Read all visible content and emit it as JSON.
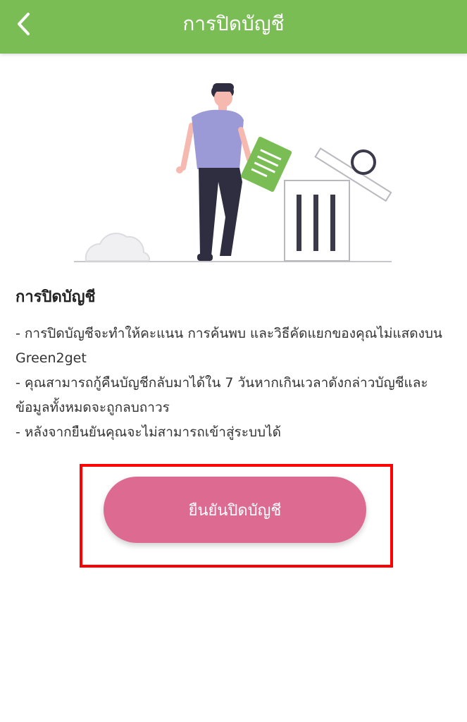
{
  "header": {
    "title": "การปิดบัญชี",
    "background_color": "#7bbd55",
    "back_icon": "chevron-left-icon"
  },
  "content": {
    "section_title": "การปิดบัญชี",
    "lines": [
      "- การปิดบัญชีจะทำให้คะแนน การค้นพบ และวิธีคัดแยกของคุณไม่แสดงบน  Green2get",
      "- คุณสามารถกู้คืนบัญชีกลับมาได้ใน 7 วันหากเกินเวลาดังกล่าวบัญชีและข้อมูลทั้งหมดจะถูกลบถาวร",
      "- หลังจากยืนยันคุณจะไม่สามารถเข้าสู่ระบบได้"
    ]
  },
  "actions": {
    "confirm_label": "ยืนยันปิดบัญชี",
    "confirm_color": "#dd6b91",
    "highlight_color": "#ff0000"
  },
  "illustration": {
    "icon": "person-deleting-document-illustration"
  }
}
